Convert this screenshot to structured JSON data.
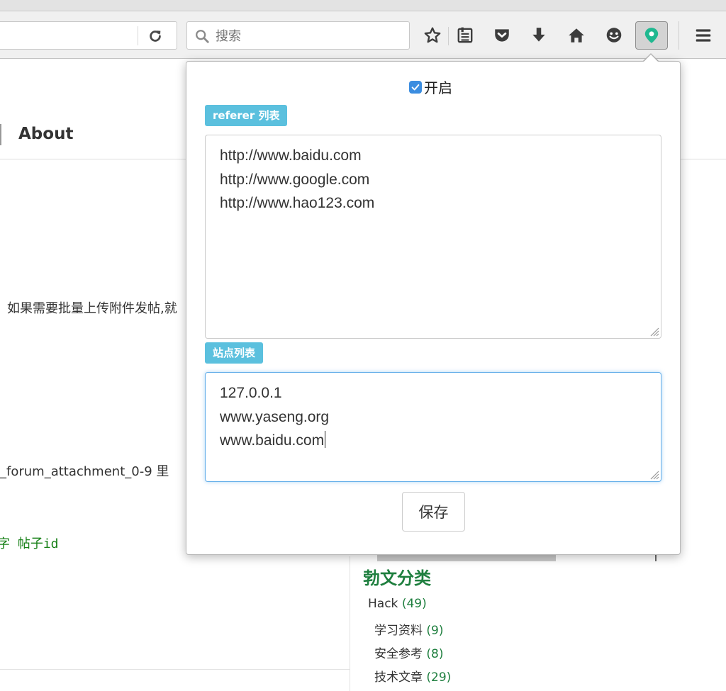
{
  "toolbar": {
    "search_placeholder": "搜索"
  },
  "page": {
    "nav_about": "About",
    "text_line1": "如果需要批量上传附件发帖,就",
    "text_line2": "_forum_attachment_0-9 里",
    "code_line": "字 帖子id"
  },
  "sidebar": {
    "title": "勃文分类",
    "categories": [
      {
        "name": "Hack",
        "count": "(49)"
      },
      {
        "name": "学习资料",
        "count": "(9)"
      },
      {
        "name": "安全参考",
        "count": "(8)"
      },
      {
        "name": "技术文章",
        "count": "(29)"
      }
    ]
  },
  "popup": {
    "enable_label": "开启",
    "enabled": true,
    "referer_label": "referer 列表",
    "referer_list": [
      "http://www.baidu.com",
      "http://www.google.com",
      "http://www.hao123.com"
    ],
    "site_label": "站点列表",
    "site_list": [
      "127.0.0.1",
      "www.yaseng.org",
      "www.baidu.com"
    ],
    "save_label": "保存"
  },
  "colors": {
    "badge": "#5bc0de",
    "checkbox": "#3b8de0",
    "link_green": "#1f7f3f",
    "focus_border": "#66afe9",
    "extension_icon": "#1fb890"
  }
}
